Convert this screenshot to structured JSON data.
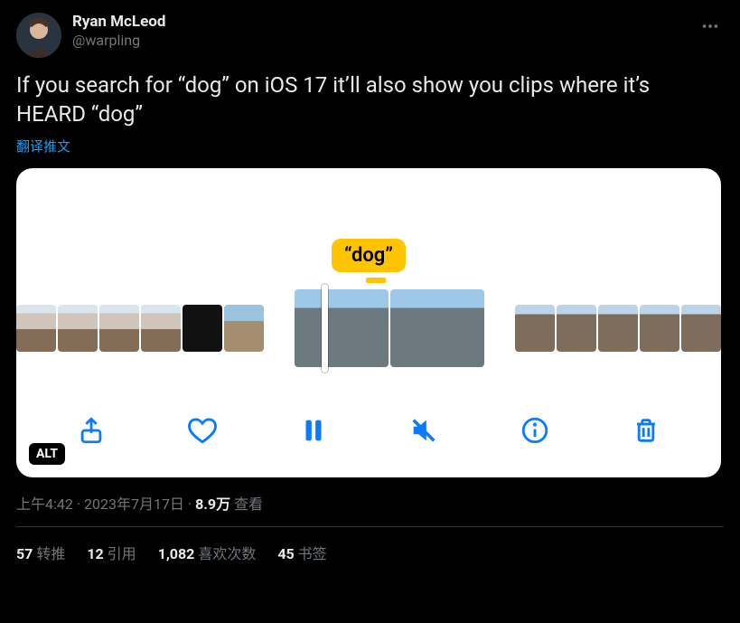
{
  "author": {
    "display_name": "Ryan McLeod",
    "handle": "@warpling"
  },
  "tweet_text": "If you search for “dog” on iOS 17 it’ll also show you clips where it’s HEARD “dog”",
  "translate_label": "翻译推文",
  "media": {
    "caption_bubble": "“dog”",
    "alt_badge": "ALT",
    "toolbar": {
      "share": "share-icon",
      "like": "heart-icon",
      "pause": "pause-icon",
      "mute": "mute-icon",
      "info": "info-icon",
      "trash": "trash-icon"
    }
  },
  "meta": {
    "time": "上午4:42",
    "sep1": " · ",
    "date": "2023年7月17日",
    "sep2": " · ",
    "views_count": "8.9万",
    "views_label": " 查看"
  },
  "stats": {
    "retweets": {
      "count": "57",
      "label": " 转推"
    },
    "quotes": {
      "count": "12",
      "label": " 引用"
    },
    "likes": {
      "count": "1,082",
      "label": " 喜欢次数"
    },
    "bookmarks": {
      "count": "45",
      "label": " 书签"
    }
  }
}
